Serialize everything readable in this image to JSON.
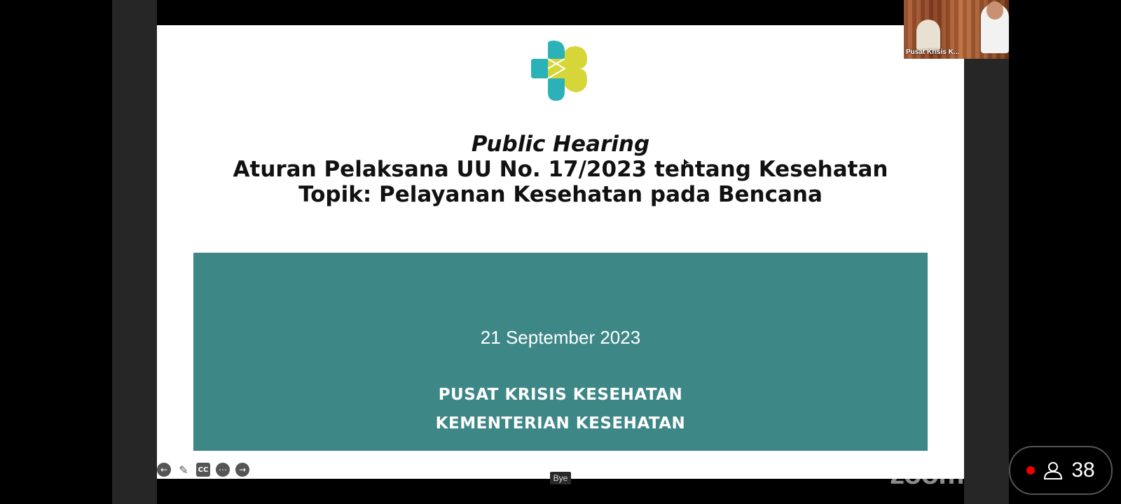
{
  "slide": {
    "title_italic": "Public Hearing",
    "title_line2": "Aturan Pelaksana UU No. 17/2023 tentang Kesehatan",
    "title_line3": "Topik: Pelayanan Kesehatan pada Bencana",
    "date": "21 September 2023",
    "org_line1": "PUSAT KRISIS KESEHATAN",
    "org_line2": "KEMENTERIAN KESEHATAN",
    "panel_color": "#3e8787",
    "logo_colors": [
      "#2bb2b8",
      "#d6d639"
    ]
  },
  "controls": {
    "prev_icon": "arrow-left-icon",
    "annotate_icon": "pencil-icon",
    "cc_label": "CC",
    "more_icon": "more-icon",
    "next_icon": "arrow-right-icon"
  },
  "bye_label": "Bye",
  "watermark": "zoom",
  "video_tile": {
    "name": "Pusat Krisis K..."
  },
  "participants": {
    "count": "38",
    "recording_color": "#ee0000"
  }
}
